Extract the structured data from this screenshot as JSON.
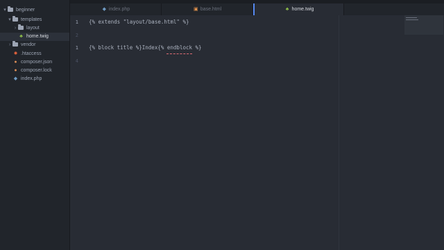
{
  "sidebar": {
    "root": "beginner",
    "items": [
      {
        "label": "templates",
        "kind": "folder",
        "open": true,
        "icon": "folder-icon"
      },
      {
        "label": "layout",
        "kind": "folder",
        "open": false,
        "icon": "folder-icon"
      },
      {
        "label": "home.twig",
        "kind": "file",
        "icon": "twig-icon"
      },
      {
        "label": "vendor",
        "kind": "folder",
        "open": false,
        "icon": "folder-icon"
      },
      {
        "label": ".htaccess",
        "kind": "file",
        "icon": "gear-icon"
      },
      {
        "label": "composer.json",
        "kind": "file",
        "icon": "composer-icon"
      },
      {
        "label": "composer.lock",
        "kind": "file",
        "icon": "composer-icon"
      },
      {
        "label": "index.php",
        "kind": "file",
        "icon": "php-icon"
      }
    ]
  },
  "tabs": [
    {
      "label": "index.php",
      "icon": "php-icon",
      "active": false
    },
    {
      "label": "base.html",
      "icon": "html-icon",
      "active": false
    },
    {
      "label": "home.twig",
      "icon": "twig-icon",
      "active": true
    }
  ],
  "editor": {
    "lines": [
      {
        "num": "1",
        "text": "{% extends \"layout/base.html\" %}"
      },
      {
        "num": "2",
        "text": ""
      },
      {
        "num": "1",
        "text": "{% block title %}Index{% endblock %}"
      },
      {
        "num": "4",
        "text": ""
      }
    ]
  },
  "colors": {
    "accent": "#568af2",
    "error_underline": "#e06c75",
    "folder": "#9da5b4",
    "php": "#6e9ac2",
    "html": "#e5944e",
    "twig": "#8fbf4a",
    "composer": "#d98c56",
    "gear": "#e0623c"
  }
}
